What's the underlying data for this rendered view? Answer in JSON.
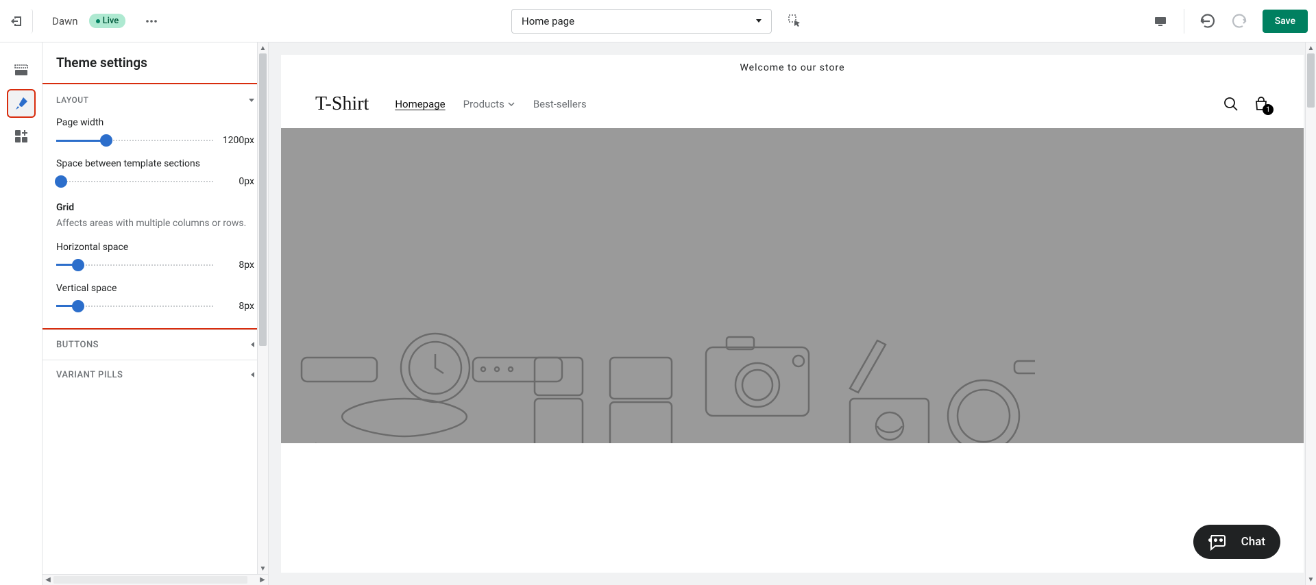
{
  "topbar": {
    "theme_name": "Dawn",
    "live_label": "Live",
    "page_select": "Home page",
    "save_label": "Save"
  },
  "sidebar": {
    "title": "Theme settings",
    "section_header": "LAYOUT",
    "page_width": {
      "label": "Page width",
      "value": "1200px",
      "fill_pct": 32
    },
    "section_space": {
      "label": "Space between template sections",
      "value": "0px",
      "fill_pct": 0
    },
    "grid": {
      "title": "Grid",
      "desc": "Affects areas with multiple columns or rows."
    },
    "h_space": {
      "label": "Horizontal space",
      "value": "8px",
      "fill_pct": 14
    },
    "v_space": {
      "label": "Vertical space",
      "value": "8px",
      "fill_pct": 14
    },
    "buttons_section": "BUTTONS",
    "variant_section": "VARIANT PILLS"
  },
  "preview": {
    "announcement": "Welcome to our store",
    "logo": "T-Shirt",
    "nav": {
      "home": "Homepage",
      "products": "Products",
      "best": "Best-sellers"
    },
    "cart_count": "1",
    "chat_label": "Chat"
  }
}
